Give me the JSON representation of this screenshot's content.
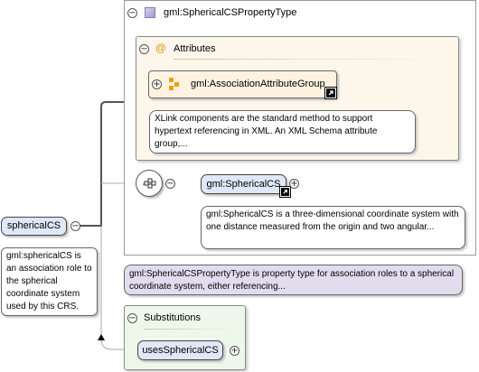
{
  "property_type": {
    "name": "gml:SphericalCSPropertyType",
    "description": "gml:SphericalCSPropertyType is property type for association roles to a spherical coordinate system, either referencing..."
  },
  "attributes": {
    "title": "Attributes",
    "group_name": "gml:AssociationAttributeGroup",
    "group_description": "XLink components are the standard method to support hypertext referencing in XML. An XML Schema attribute group,..."
  },
  "child_element": {
    "name": "gml:SphericalCS",
    "description": "gml:SphericalCS is a three-dimensional coordinate system with one distance measured from the origin and two angular..."
  },
  "root_element": {
    "name": "sphericalCS",
    "description": "gml:sphericalCS is an association role to the spherical coordinate system used by this CRS."
  },
  "substitutions": {
    "title": "Substitutions",
    "items": [
      "usesSphericalCS"
    ]
  },
  "icons": {
    "type_icon": "complex-type-icon",
    "attribute_icon": "at-sign-icon",
    "group_icon": "attribute-group-icon",
    "sequence_icon": "sequence-compositor-icon",
    "expand": "plus-icon",
    "collapse": "minus-icon",
    "reference": "reference-arrow-icon"
  },
  "colors": {
    "element_fill": "#dfe8f8",
    "attribute_fill": "#fdf6ea",
    "type_note_fill": "#e2dcef",
    "substitution_fill": "#eef8ea"
  }
}
